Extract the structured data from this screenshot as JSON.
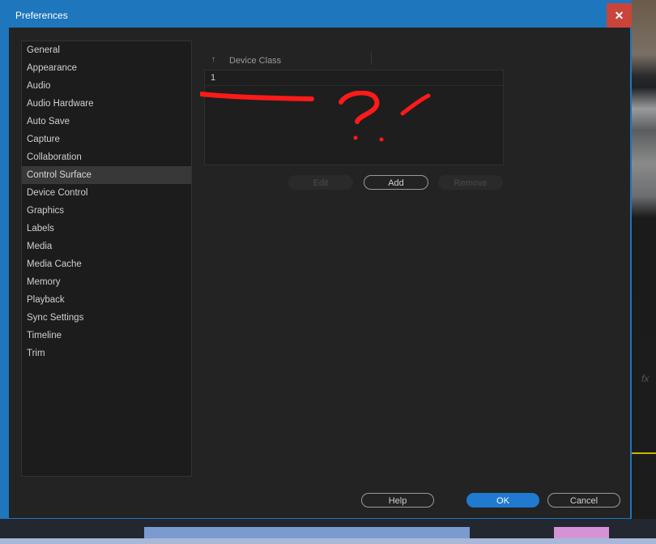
{
  "window": {
    "title": "Preferences",
    "close_label": "✕"
  },
  "sidebar": {
    "items": [
      {
        "label": "General"
      },
      {
        "label": "Appearance"
      },
      {
        "label": "Audio"
      },
      {
        "label": "Audio Hardware"
      },
      {
        "label": "Auto Save"
      },
      {
        "label": "Capture"
      },
      {
        "label": "Collaboration"
      },
      {
        "label": "Control Surface",
        "selected": true
      },
      {
        "label": "Device Control"
      },
      {
        "label": "Graphics"
      },
      {
        "label": "Labels"
      },
      {
        "label": "Media"
      },
      {
        "label": "Media Cache"
      },
      {
        "label": "Memory"
      },
      {
        "label": "Playback"
      },
      {
        "label": "Sync Settings"
      },
      {
        "label": "Timeline"
      },
      {
        "label": "Trim"
      }
    ]
  },
  "device_table": {
    "sort_icon": "↑",
    "column_header": "Device Class",
    "rows": [
      "1"
    ]
  },
  "table_buttons": {
    "edit": "Edit",
    "add": "Add",
    "remove": "Remove"
  },
  "footer": {
    "help": "Help",
    "ok": "OK",
    "cancel": "Cancel"
  },
  "colors": {
    "title_bar": "#1e76bd",
    "close_button": "#c9443b",
    "primary_button": "#1f7ad0",
    "annotation": "#ff0000"
  },
  "background_app": {
    "fx_label": "fx"
  }
}
